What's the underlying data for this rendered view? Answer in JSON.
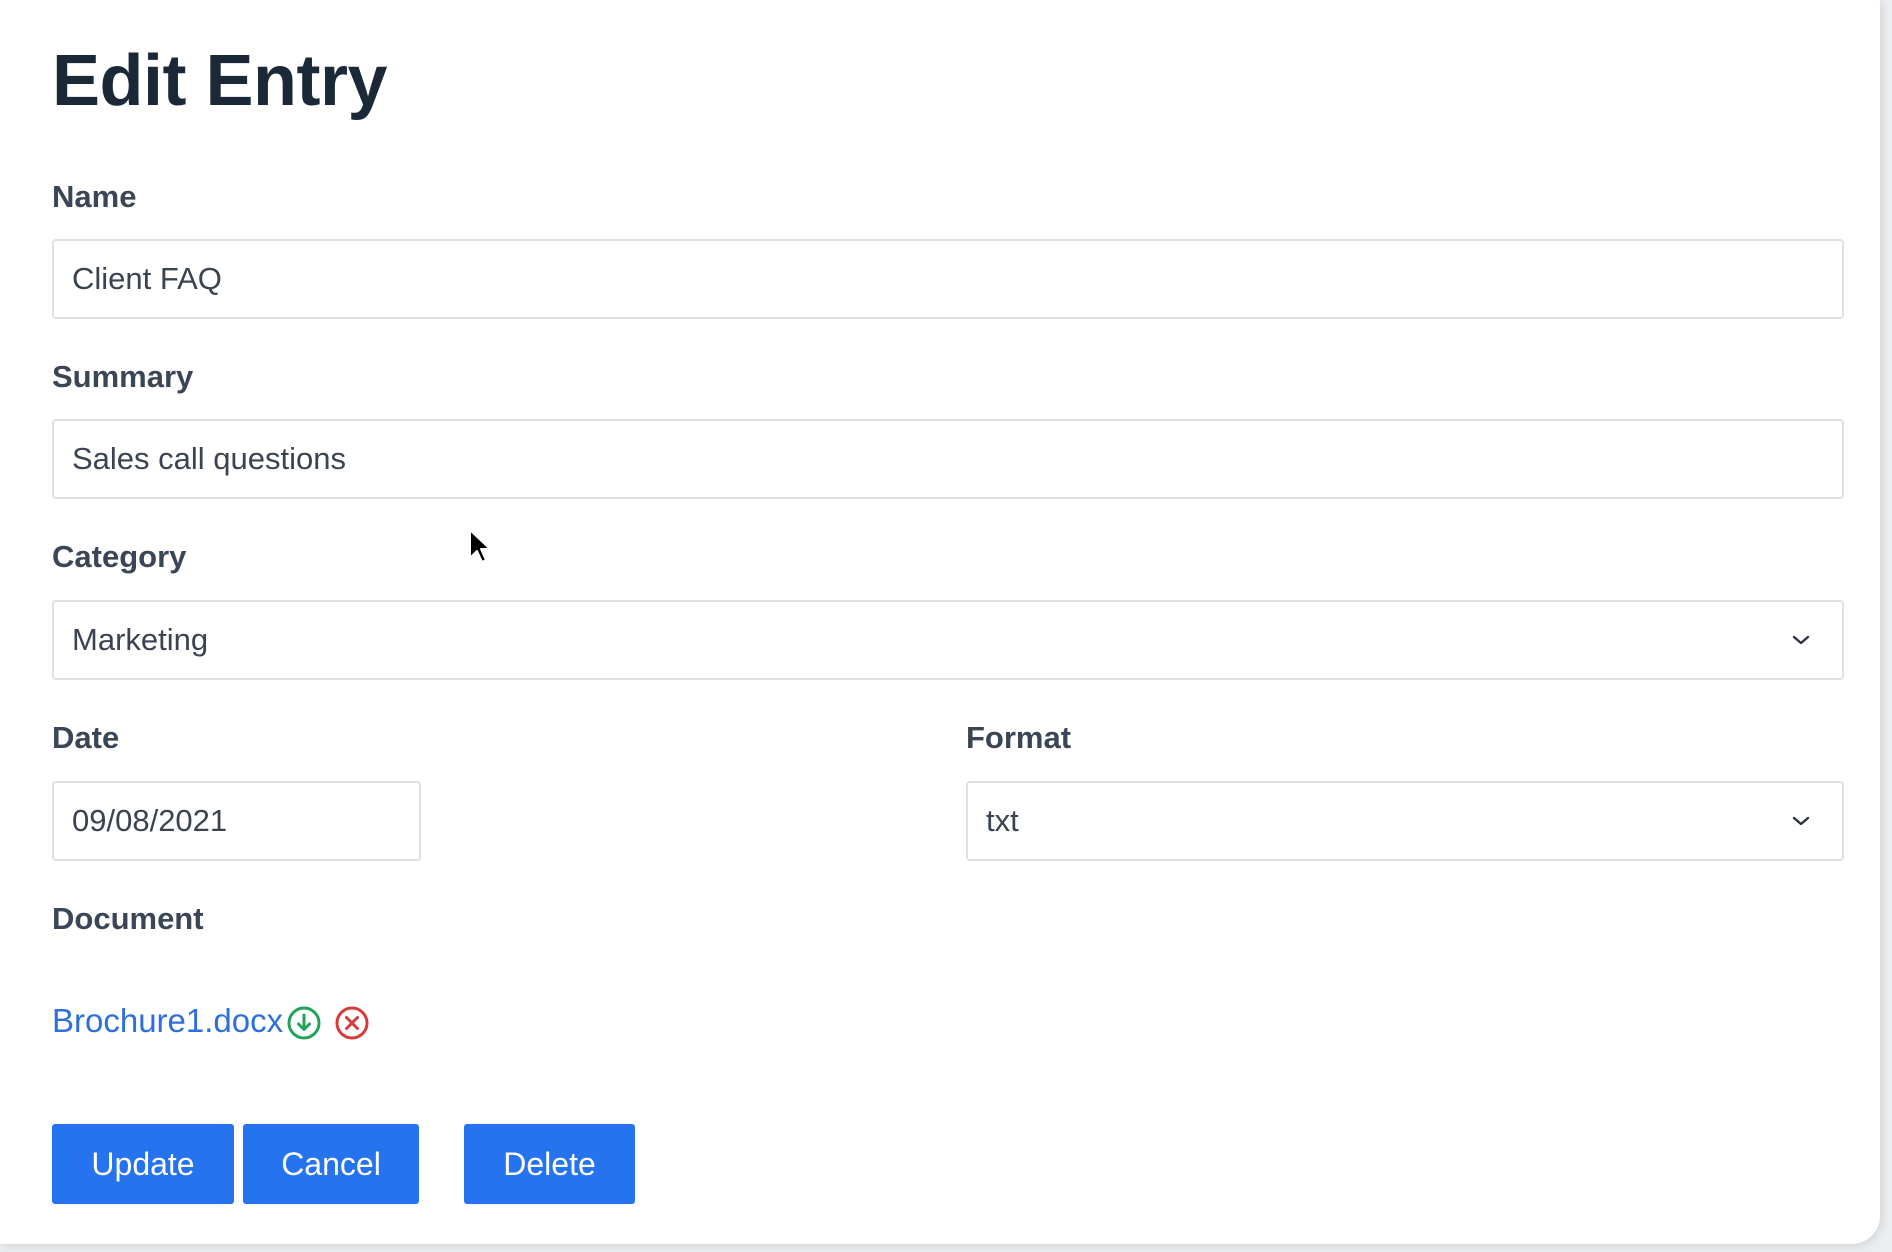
{
  "page": {
    "title": "Edit Entry"
  },
  "form": {
    "name": {
      "label": "Name",
      "value": "Client FAQ"
    },
    "summary": {
      "label": "Summary",
      "value": "Sales call questions"
    },
    "category": {
      "label": "Category",
      "selected": "Marketing"
    },
    "date": {
      "label": "Date",
      "value": "09/08/2021"
    },
    "format": {
      "label": "Format",
      "selected": "txt"
    },
    "document": {
      "label": "Document",
      "filename": "Brochure1.docx",
      "download_icon": "download-circle-icon",
      "remove_icon": "close-circle-icon"
    }
  },
  "actions": {
    "update_label": "Update",
    "cancel_label": "Cancel",
    "delete_label": "Delete"
  },
  "colors": {
    "primary": "#2673f0",
    "title": "#1a2838",
    "label": "#3a4656",
    "link": "#2f6fdc",
    "download_green": "#22a35a",
    "remove_red": "#d63a3a"
  }
}
